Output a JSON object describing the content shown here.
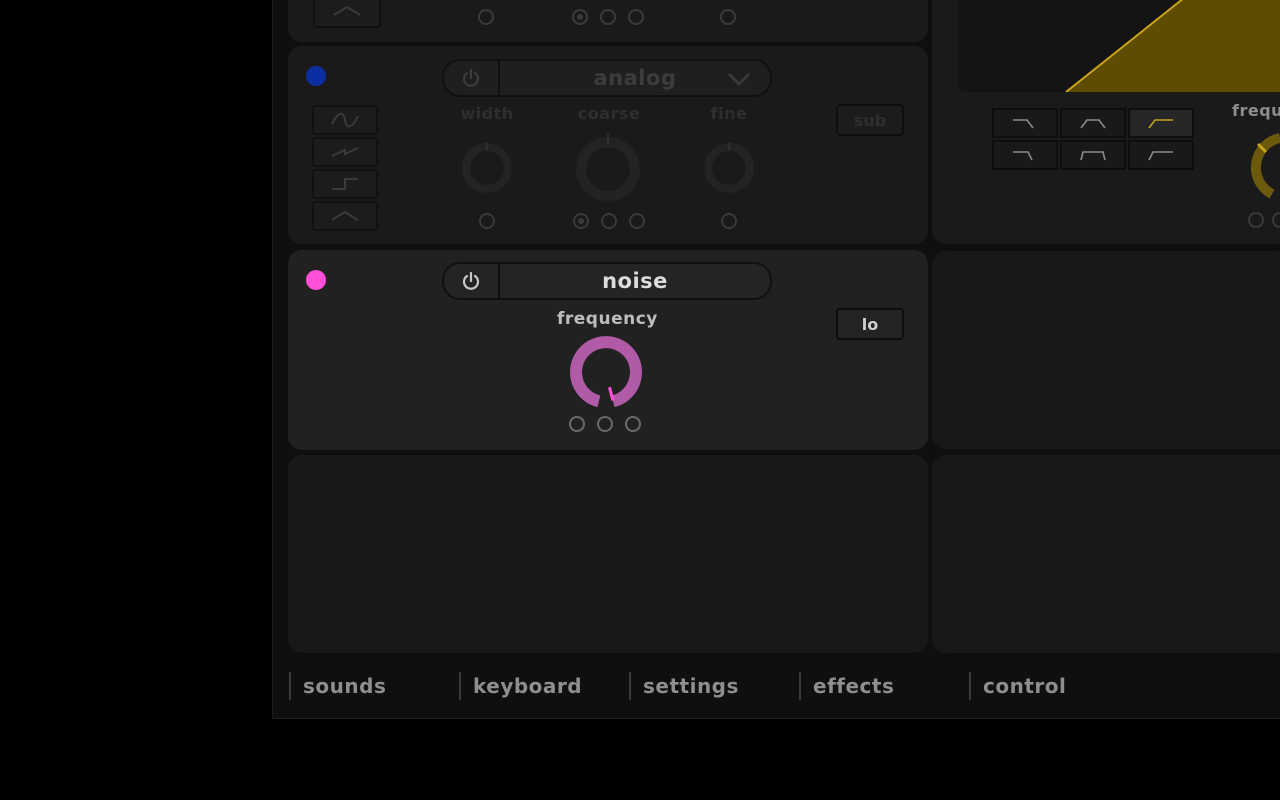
{
  "oscillator_1": {
    "type_label": "analog",
    "knob_labels": [
      "width",
      "coarse",
      "fine"
    ],
    "sub_label": "sub",
    "color": "#0a2fa0"
  },
  "noise": {
    "type_label": "noise",
    "knob_label": "frequency",
    "frequency_value": 0.95,
    "filter_label": "lo",
    "color": "#ff4fd8",
    "knob_color": "#b05aa8"
  },
  "filter": {
    "knob_label": "frequ",
    "accent_color": "#c9a415",
    "curve_fill": "#5e4d00",
    "active_shape": "highpass"
  },
  "nav": {
    "tabs": [
      "sounds",
      "keyboard",
      "settings",
      "effects",
      "control"
    ]
  }
}
